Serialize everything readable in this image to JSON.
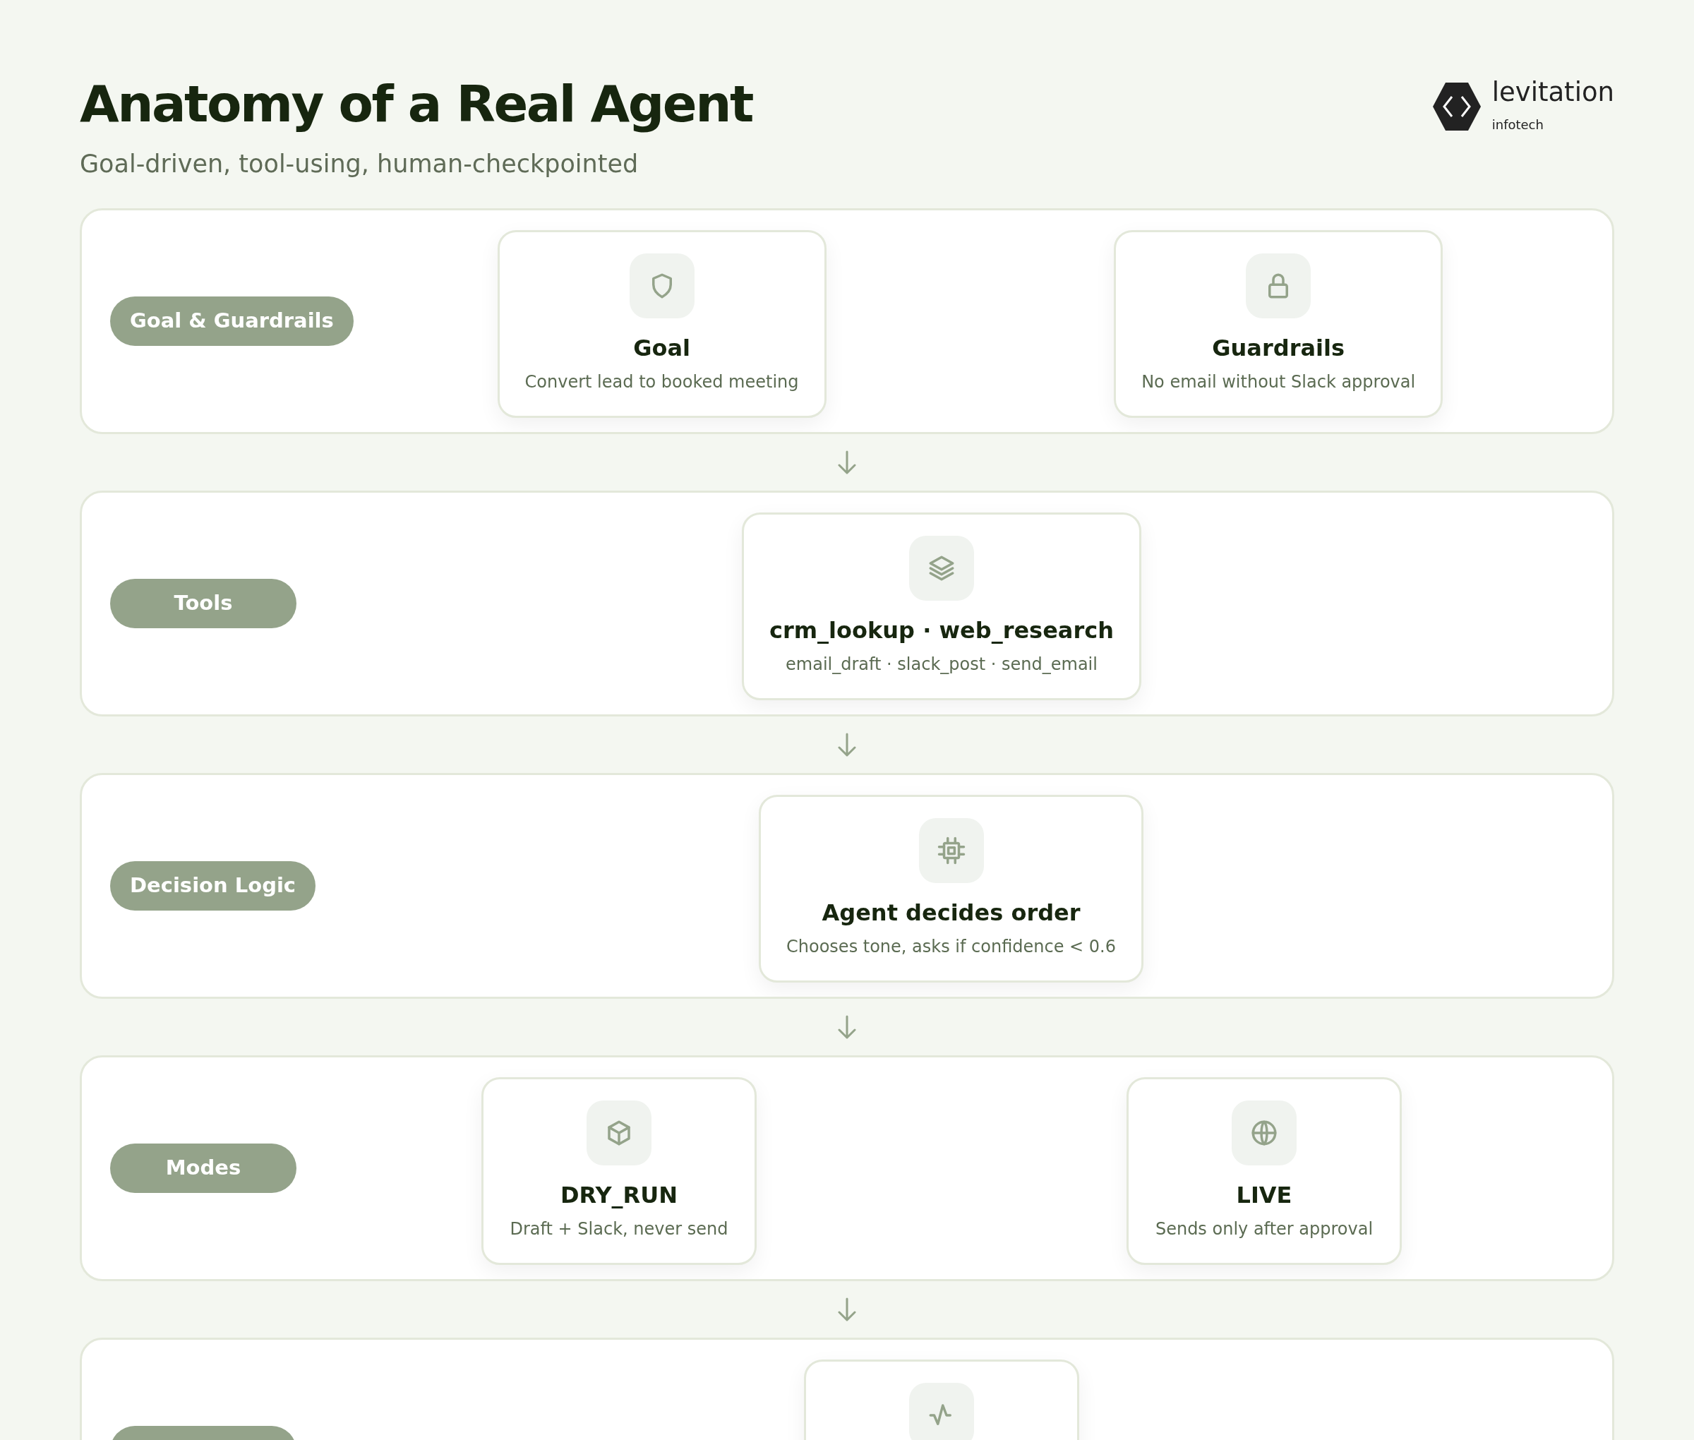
{
  "header": {
    "title": "Anatomy of a Real Agent",
    "subtitle": "Goal-driven, tool-using, human-checkpointed"
  },
  "logo": {
    "name": "levitation",
    "tagline": "infotech"
  },
  "stages": [
    {
      "label": "Goal & Guardrails",
      "cards": [
        {
          "kind": "shield",
          "title": "Goal",
          "description": "Convert lead to booked meeting"
        },
        {
          "kind": "lock",
          "title": "Guardrails",
          "description": "No email without Slack approval"
        }
      ]
    },
    {
      "label": "Tools",
      "cards": [
        {
          "kind": "layers",
          "title": "crm_lookup · web_research",
          "description": "email_draft · slack_post · send_email"
        }
      ]
    },
    {
      "label": "Decision Logic",
      "cards": [
        {
          "kind": "chip",
          "title": "Agent decides order",
          "description": "Chooses tone, asks if confidence < 0.6"
        }
      ]
    },
    {
      "label": "Modes",
      "cards": [
        {
          "kind": "cube",
          "title": "DRY_RUN",
          "description": "Draft + Slack, never send"
        },
        {
          "kind": "globe",
          "title": "LIVE",
          "description": "Sends only after approval"
        }
      ]
    },
    {
      "cards": [
        {
          "kind": "pulse"
        }
      ]
    }
  ]
}
